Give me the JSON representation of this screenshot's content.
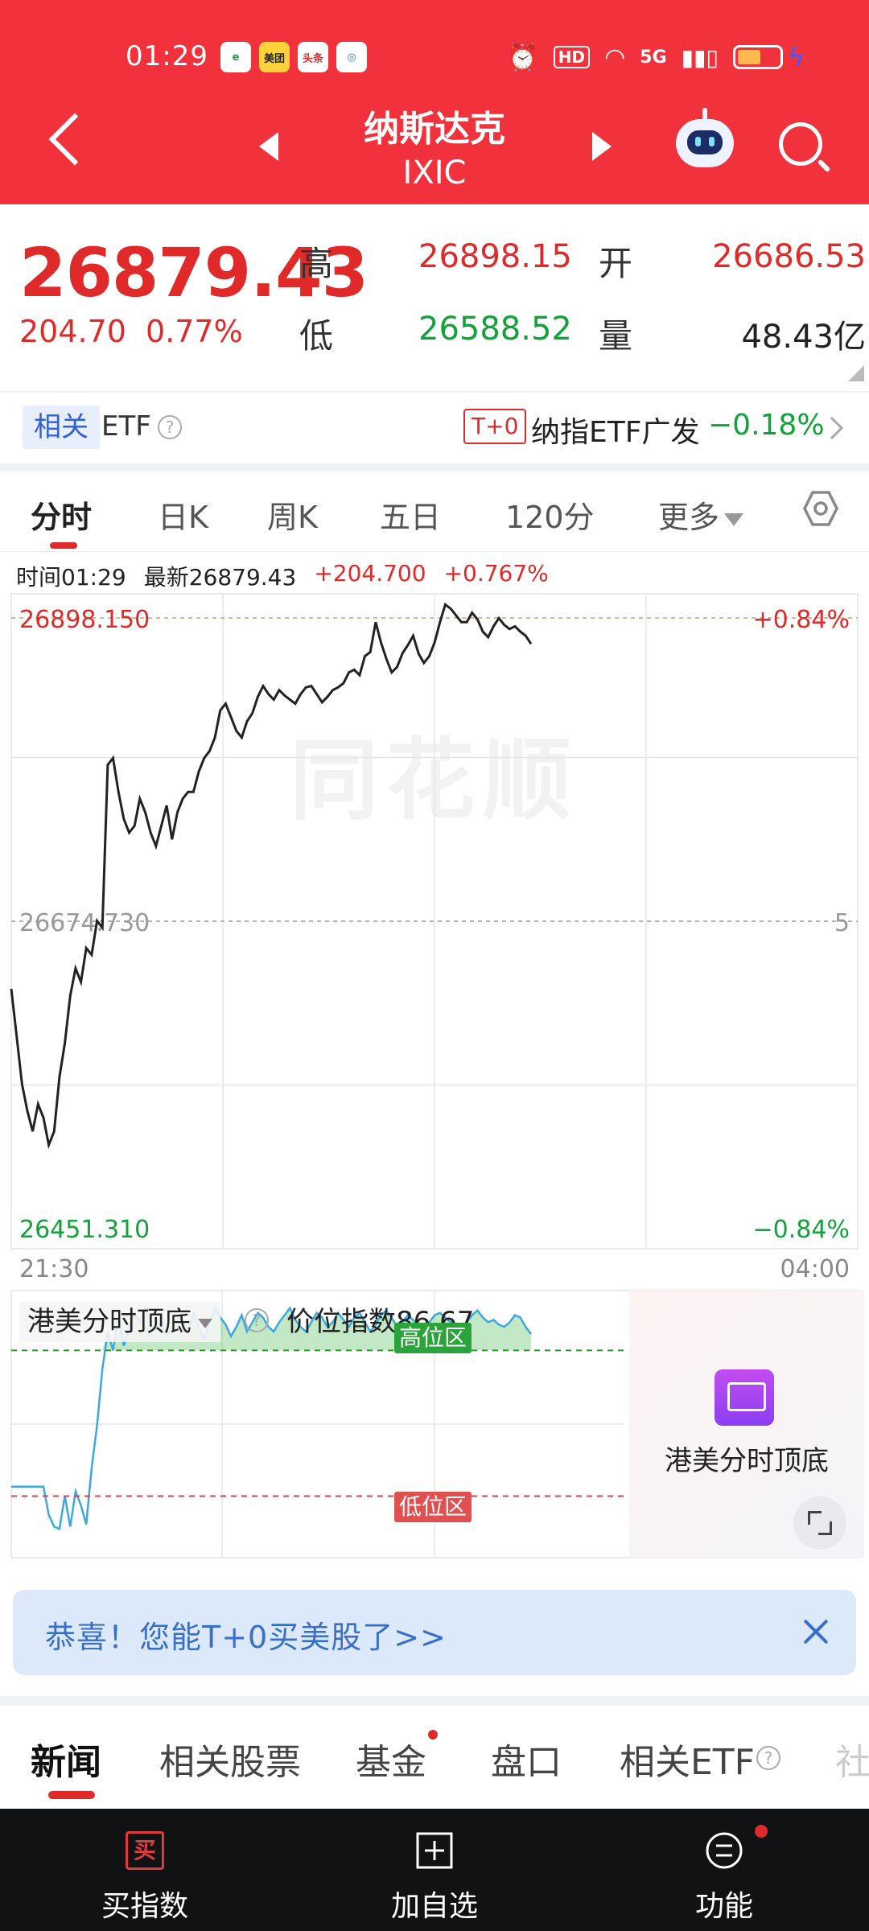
{
  "status_bar": {
    "time": "01:29",
    "apps": [
      "e",
      "美团",
      "头条",
      "◎"
    ],
    "hd": "HD",
    "network": "5G"
  },
  "header": {
    "name": "纳斯达克",
    "code": "IXIC"
  },
  "quote": {
    "price": "26879.43",
    "change": "204.70",
    "change_pct": "0.77%",
    "high_label": "高",
    "high": "26898.15",
    "low_label": "低",
    "low": "26588.52",
    "open_label": "开",
    "open": "26686.53",
    "volume_label": "量",
    "volume": "48.43亿"
  },
  "etf_bar": {
    "tag": "相关",
    "label": "ETF",
    "badge": "T+0",
    "fund_name": "纳指ETF广发",
    "fund_change": "−0.18%"
  },
  "tabs": {
    "items": [
      "分时",
      "日K",
      "周K",
      "五日",
      "120分",
      "更多"
    ],
    "active": "分时"
  },
  "chart_info": {
    "time_label": "时间01:29",
    "latest_label": "最新26879.43",
    "change": "+204.700",
    "change_pct": "+0.767%"
  },
  "chart_data": {
    "type": "line",
    "title": "",
    "x_start": "21:30",
    "x_end": "04:00",
    "ylim": [
      26451.31,
      26898.15
    ],
    "y_top_label": "26898.150",
    "y_mid_label": "26674.730",
    "y_bottom_label": "26451.310",
    "pct_top_label": "+0.84%",
    "pct_bottom_label": "−0.84%",
    "pct_mid_label": "5",
    "previous_close": 26674.73,
    "grid": true,
    "series": [
      {
        "values": [
          26625,
          26590,
          26555,
          26535,
          26520,
          26540,
          26530,
          26510,
          26520,
          26560,
          26585,
          26620,
          26640,
          26630,
          26655,
          26650,
          26675,
          26670,
          26790,
          26795,
          26770,
          26750,
          26740,
          26745,
          26765,
          26755,
          26740,
          26730,
          26745,
          26760,
          26735,
          26755,
          26765,
          26770,
          26770,
          26785,
          26795,
          26800,
          26810,
          26830,
          26835,
          26825,
          26815,
          26810,
          26822,
          26828,
          26840,
          26848,
          26842,
          26838,
          26845,
          26841,
          26838,
          26835,
          26842,
          26847,
          26848,
          26842,
          26836,
          26840,
          26845,
          26847,
          26850,
          26858,
          26860,
          26856,
          26870,
          26873,
          26895,
          26880,
          26868,
          26858,
          26862,
          26872,
          26878,
          26885,
          26872,
          26865,
          26870,
          26880,
          26895,
          26908,
          26905,
          26900,
          26895,
          26895,
          26902,
          26897,
          26888,
          26884,
          26892,
          26898,
          26893,
          26890,
          26892,
          26888,
          26885,
          26879
        ]
      }
    ]
  },
  "sub_indicator": {
    "title": "港美分时顶底",
    "value_label": "价位指数86.67",
    "high_zone": "高位区",
    "low_zone": "低位区",
    "values": [
      22,
      22,
      22,
      22,
      22,
      22,
      22,
      10,
      5,
      4,
      18,
      5,
      20,
      14,
      6,
      30,
      48,
      72,
      88,
      80,
      95,
      82,
      90,
      96,
      92,
      98,
      91,
      88,
      95,
      86,
      90,
      94,
      92,
      88,
      96,
      90,
      85,
      92,
      98,
      94,
      91,
      86,
      90,
      95,
      88,
      92,
      96,
      94,
      90,
      88,
      92,
      95,
      98,
      93,
      90,
      88,
      92,
      96,
      94,
      90,
      92,
      96,
      93,
      90,
      94,
      96,
      92,
      88,
      91,
      95,
      97,
      94,
      90,
      92,
      95,
      93,
      90,
      88,
      92,
      95,
      96,
      94,
      92,
      90,
      88,
      92,
      95,
      97,
      94,
      92,
      93,
      91,
      90,
      92,
      95,
      94,
      90,
      87
    ]
  },
  "promo": {
    "label": "港美分时顶底"
  },
  "banner": {
    "text": "恭喜！您能T+0买美股了>>"
  },
  "news_tabs": {
    "items": [
      "新闻",
      "相关股票",
      "基金",
      "盘口",
      "相关ETF",
      "社"
    ],
    "active": "新闻"
  },
  "bottom_nav": {
    "buy": "买指数",
    "buy_icon_char": "买",
    "add": "加自选",
    "func": "功能"
  },
  "colors": {
    "header": "#f1323c",
    "up": "#e02a2a",
    "down": "#11a33a",
    "link": "#3a6fc7"
  }
}
